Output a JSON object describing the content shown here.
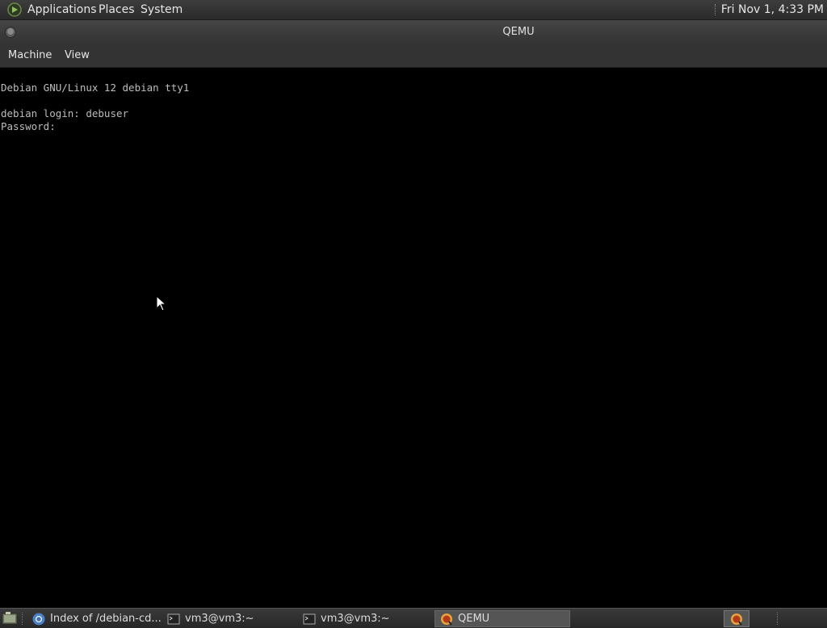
{
  "top_panel": {
    "menus": [
      "Applications",
      "Places",
      "System"
    ],
    "clock": "Fri Nov 1,  4:33 PM"
  },
  "window": {
    "title": "QEMU",
    "menus": [
      "Machine",
      "View"
    ]
  },
  "console": {
    "lines": [
      "Debian GNU/Linux 12 debian tty1",
      "",
      "debian login: debuser",
      "Password:"
    ]
  },
  "taskbar": {
    "tasks": [
      {
        "label": "Index of /debian-cd...",
        "icon": "chrome-icon",
        "active": false
      },
      {
        "label": "vm3@vm3:~",
        "icon": "terminal-icon",
        "active": false
      },
      {
        "label": "vm3@vm3:~",
        "icon": "terminal-icon",
        "active": false
      },
      {
        "label": "QEMU",
        "icon": "qemu-icon",
        "active": true
      }
    ]
  },
  "colors": {
    "panel_bg": "#2f2f2f",
    "console_bg": "#000000",
    "console_fg": "#bdbdbd",
    "accent_green": "#7fa650"
  }
}
